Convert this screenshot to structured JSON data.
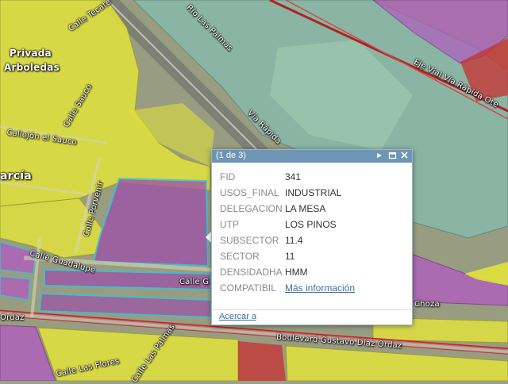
{
  "map": {
    "labels": {
      "privada_arboledas_1": "Privada",
      "privada_arboledas_2": "Arboledas",
      "calle_tecate": "Calle Tecate",
      "rio_las_palmas": "Río Las Palmas",
      "eje_vial": "Eje Vial Vía Rápida Ote",
      "via_rapida": "Vía Rápida",
      "calle_sauco": "Calle Sauco",
      "callejon_sauco": "Callejón el Sauco",
      "garcia": "arcía",
      "calle_porvenir": "Calle Porvenir",
      "calle_guadalupe_1": "Calle Guadalupe",
      "calle_guadalupe_2": "Calle G",
      "choza": "Choza",
      "ordaz_left": "Ordaz",
      "boulevard": "Boulevard Gustavo Díaz Ordaz",
      "calle_las_flores": "Calle Las Flores",
      "calle_las_palmas": "Calle Las Palmas"
    },
    "zone_colors": {
      "residential": "#e6e63a",
      "industrial": "#9c52a8",
      "commercial": "#c03030",
      "green": "#7fc8c0",
      "outline": "#28c8e0"
    }
  },
  "popup": {
    "count": "(1 de 3)",
    "icons": [
      "next-icon",
      "maximize-icon",
      "close-icon"
    ],
    "fields": [
      {
        "key": "FID",
        "value": "341"
      },
      {
        "key": "USOS_FINAL",
        "value": "INDUSTRIAL"
      },
      {
        "key": "DELEGACION",
        "value": "LA MESA"
      },
      {
        "key": "UTP",
        "value": "LOS PINOS"
      },
      {
        "key": "SUBSECTOR",
        "value": "11.4"
      },
      {
        "key": "SECTOR",
        "value": "11"
      },
      {
        "key": "DENSIDADHA",
        "value": "HMM"
      },
      {
        "key": "COMPATIBIL",
        "value": "Más información"
      }
    ],
    "zoom_link": "Acercar a"
  }
}
